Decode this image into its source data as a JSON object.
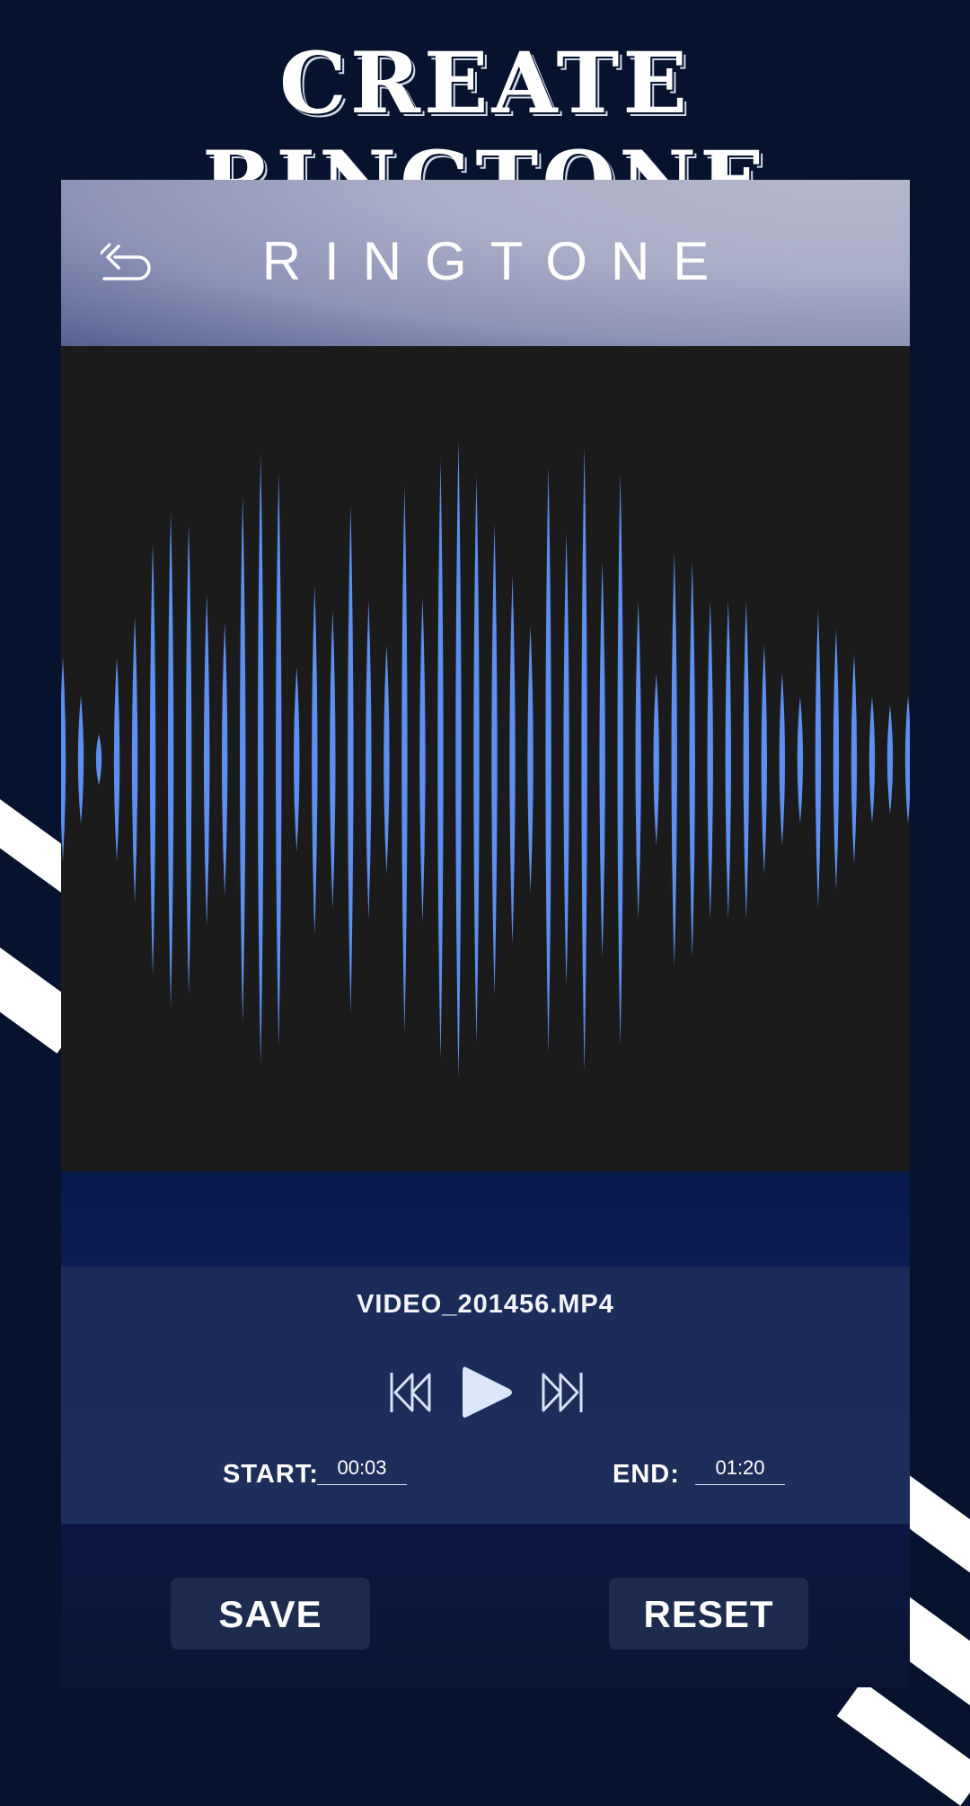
{
  "page": {
    "title": "CREATE RINGTONE"
  },
  "app": {
    "header_title": "RINGTONE",
    "back_icon": "undo-back-icon"
  },
  "waveform": {
    "color": "#5b8ff0",
    "bar_amplitudes": [
      0.32,
      0.2,
      0.08,
      0.32,
      0.45,
      0.68,
      0.78,
      0.74,
      0.52,
      0.43,
      0.83,
      0.96,
      0.9,
      0.29,
      0.55,
      0.47,
      0.8,
      0.5,
      0.36,
      0.86,
      0.51,
      0.94,
      1.0,
      0.89,
      0.74,
      0.58,
      0.42,
      0.92,
      0.71,
      0.98,
      0.62,
      0.9,
      0.5,
      0.27,
      0.65,
      0.62,
      0.5,
      0.5,
      0.5,
      0.36,
      0.27,
      0.2,
      0.47,
      0.41,
      0.33,
      0.2,
      0.17,
      0.2
    ],
    "background": "#1b1b1b"
  },
  "player": {
    "file_name": "VIDEO_201456.MP4",
    "rewind_icon": "rewind-icon",
    "play_icon": "play-icon",
    "forward_icon": "fast-forward-icon",
    "start_label": "START:",
    "start_value": "00:03",
    "end_label": "END:",
    "end_value": "01:20"
  },
  "actions": {
    "save_label": "SAVE",
    "reset_label": "RESET"
  },
  "colors": {
    "page_background": "#06122e",
    "accent_blue": "#5b8ff0",
    "button_background": "#1d2b4e"
  }
}
